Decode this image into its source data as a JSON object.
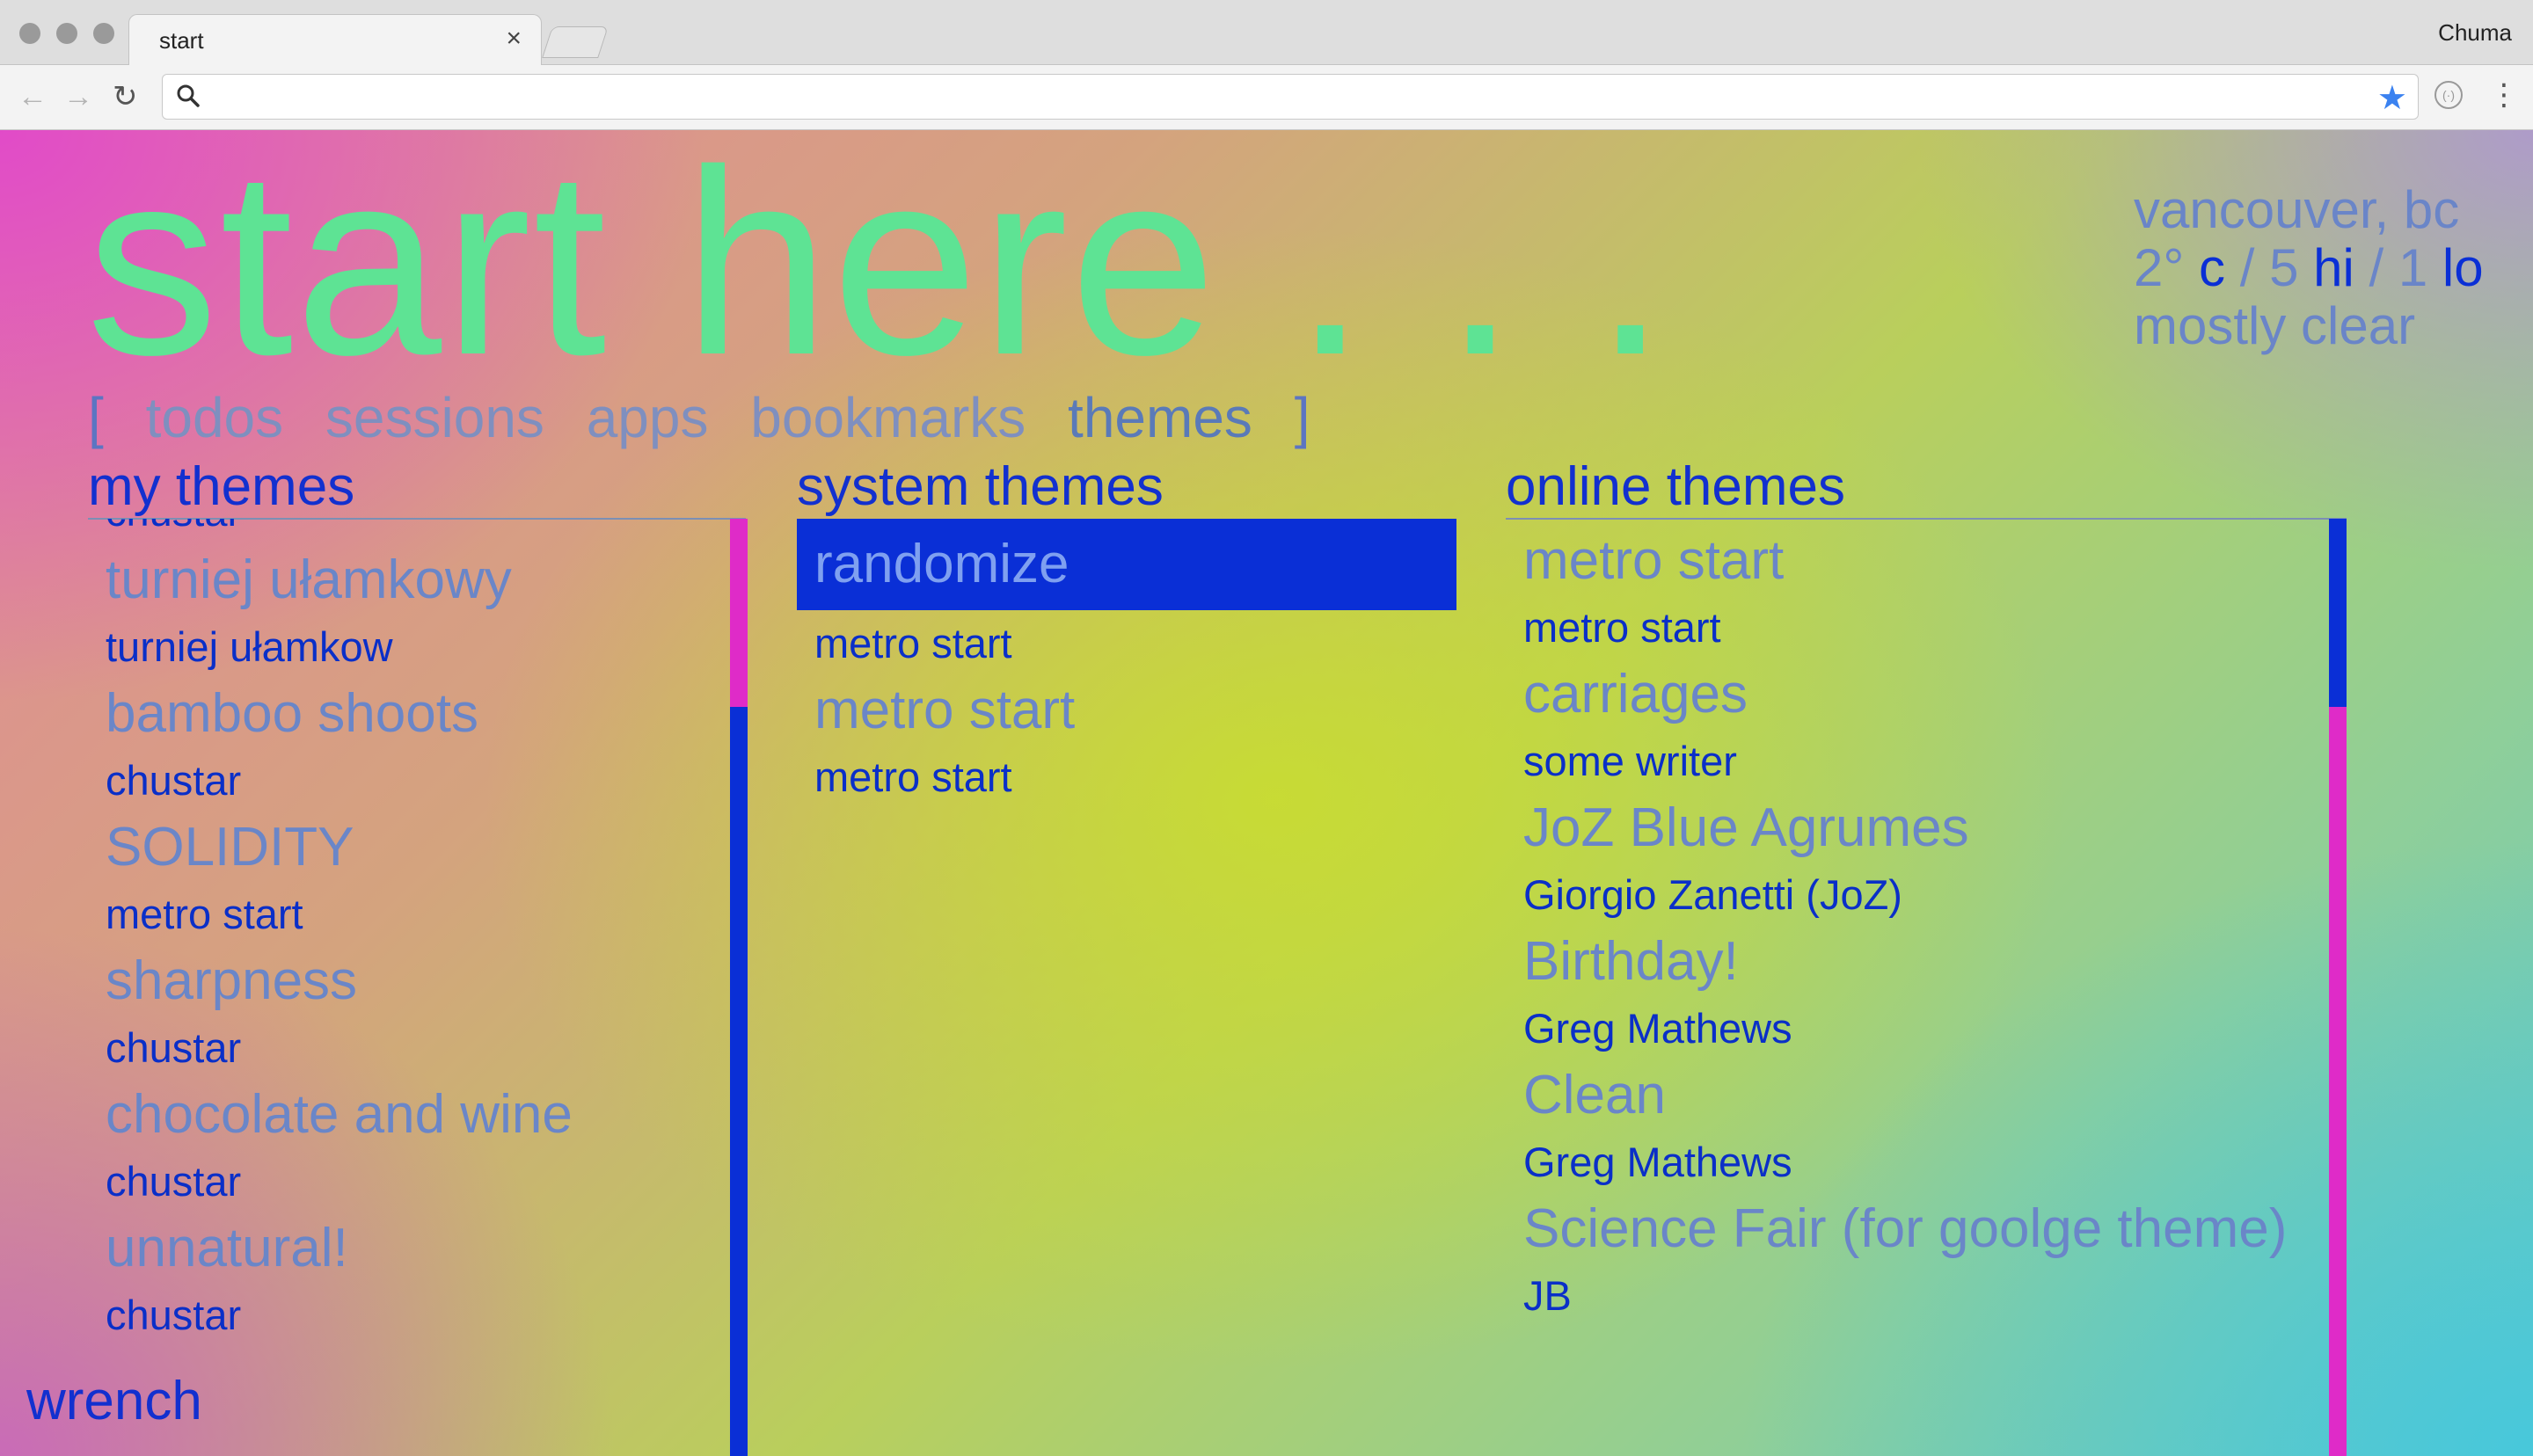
{
  "browser": {
    "tab_title": "start",
    "tab_close": "×",
    "profile_name": "Chuma",
    "back_glyph": "←",
    "forward_glyph": "→",
    "reload_glyph": "↻",
    "url_value": "",
    "bookmark_glyph": "★",
    "menu_glyph": "⋮",
    "icons": [
      "back-arrow-icon",
      "forward-arrow-icon",
      "reload-icon",
      "search-icon",
      "bookmark-star-icon",
      "extension-icon",
      "menu-icon"
    ]
  },
  "page": {
    "title": "start here . . .",
    "weather": {
      "location": "vancouver, bc",
      "temp": "2°",
      "unit": "c",
      "sep1": "/",
      "hi_val": "5",
      "hi_label": "hi",
      "sep2": "/",
      "lo_val": "1",
      "lo_label": "lo",
      "condition": "mostly clear"
    },
    "nav": {
      "open_bracket": "[",
      "items": [
        "todos",
        "sessions",
        "apps",
        "bookmarks",
        "themes"
      ],
      "close_bracket": "]",
      "active": "themes"
    },
    "my_themes": {
      "title": "my themes",
      "partial_author": "chustar",
      "items": [
        {
          "title": "turniej ułamkowy",
          "author": "turniej ułamkow"
        },
        {
          "title": "bamboo shoots",
          "author": "chustar"
        },
        {
          "title": "SOLIDITY",
          "author": "metro start"
        },
        {
          "title": "sharpness",
          "author": "chustar"
        },
        {
          "title": "chocolate and wine",
          "author": "chustar"
        },
        {
          "title": "unnatural!",
          "author": "chustar"
        }
      ],
      "scroll_position": 0.22
    },
    "system_themes": {
      "title": "system themes",
      "items": [
        {
          "title": "randomize",
          "author": "metro start",
          "selected": true
        },
        {
          "title": "metro start",
          "author": "metro start",
          "selected": false
        }
      ]
    },
    "online_themes": {
      "title": "online themes",
      "items": [
        {
          "title": "metro start",
          "author": "metro start"
        },
        {
          "title": "carriages",
          "author": "some writer"
        },
        {
          "title": "JoZ Blue Agrumes",
          "author": "Giorgio Zanetti (JoZ)"
        },
        {
          "title": "Birthday!",
          "author": "Greg Mathews"
        },
        {
          "title": "Clean",
          "author": "Greg Mathews"
        },
        {
          "title": "Science Fair (for goolge theme)",
          "author": "JB"
        }
      ],
      "scroll_position": 0.0
    },
    "footer_link": "wrench",
    "colors": {
      "accent_blue": "#0a2fd6",
      "scroll_pink": "#df2bc8",
      "hero_green": "#5ee394",
      "muted_text": "#6a86c8"
    }
  }
}
